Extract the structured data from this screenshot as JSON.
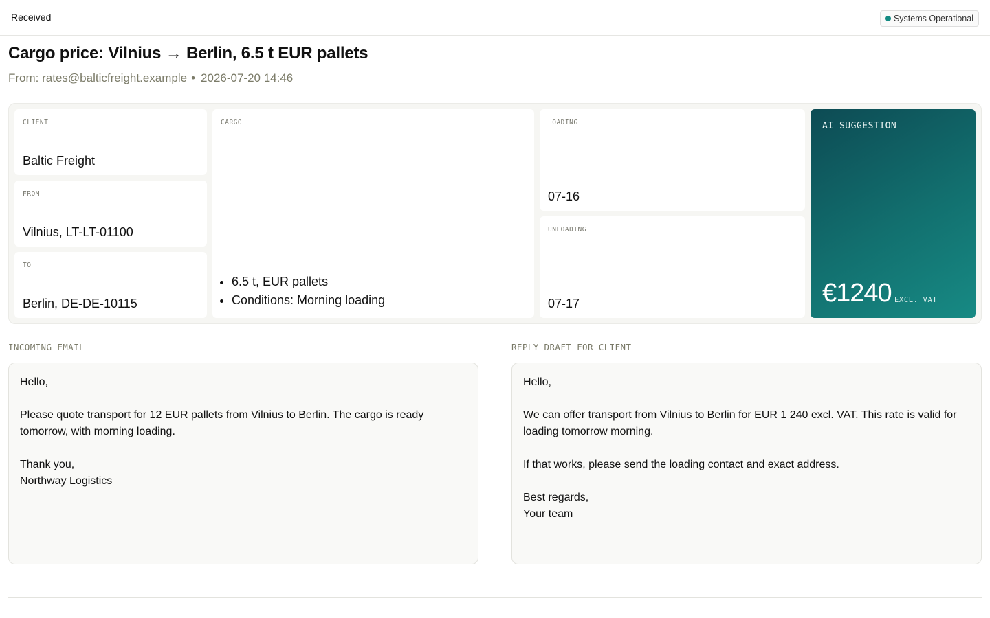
{
  "header": {
    "status_label": "Received",
    "system_status": "Systems Operational",
    "status_color": "#138a82"
  },
  "message": {
    "title": "Cargo price: Vilnius → Berlin, 6.5 t EUR pallets",
    "from": "From: rates@balticfreight.example",
    "separator": "•",
    "timestamp": "2026-07-20 14:46"
  },
  "details": {
    "client": {
      "label": "CLIENT",
      "value": "Baltic Freight"
    },
    "from": {
      "label": "FROM",
      "value": "Vilnius, LT-LT-01100"
    },
    "to": {
      "label": "TO",
      "value": "Berlin, DE-DE-10115"
    },
    "cargo": {
      "label": "CARGO",
      "items": [
        "6.5 t, EUR pallets",
        "Conditions: Morning loading"
      ]
    },
    "loading": {
      "label": "LOADING",
      "value": "07-16"
    },
    "unloading": {
      "label": "UNLOADING",
      "value": "07-17"
    }
  },
  "ai_suggestion": {
    "label": "AI SUGGESTION",
    "price": "€1240",
    "unit": "EXCL. VAT",
    "gradient_start": "#0d4b54",
    "gradient_end": "#178a84"
  },
  "incoming_email": {
    "label": "INCOMING EMAIL",
    "lines": [
      "Hello,",
      "",
      "Please quote transport for 12 EUR pallets from Vilnius to Berlin. The cargo is ready tomorrow, with morning loading.",
      "",
      "Thank you,",
      "Northway Logistics"
    ]
  },
  "reply_draft": {
    "label": "REPLY DRAFT FOR CLIENT",
    "lines": [
      "Hello,",
      "",
      "We can offer transport from Vilnius to Berlin for EUR 1 240 excl. VAT. This rate is valid for loading tomorrow morning.",
      "",
      "If that works, please send the loading contact and exact address.",
      "",
      "Best regards,",
      "Your team"
    ]
  }
}
